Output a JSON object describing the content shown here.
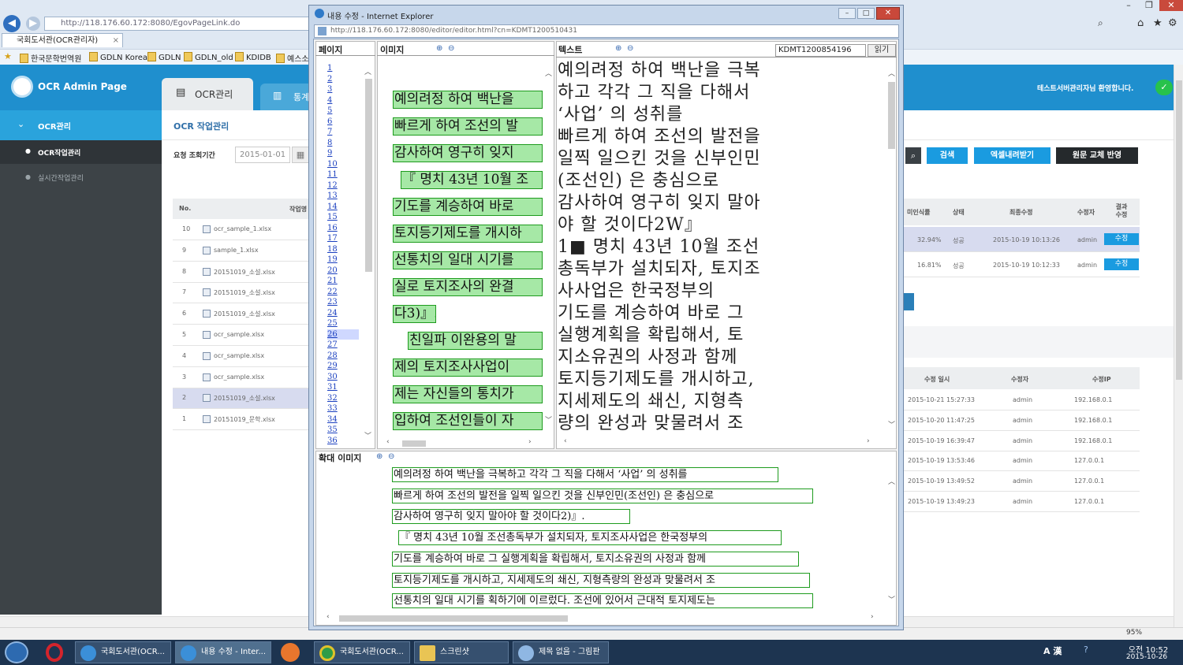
{
  "browser": {
    "address": "http://118.176.60.172:8080/EgovPageLink.do",
    "tab_title": "국회도서관(OCR관리자)",
    "favorites": [
      "한국문학번역원",
      "GDLN Korea",
      "GDLN",
      "GDLN_old",
      "KDIDB",
      "예스소"
    ],
    "zoom": "95%"
  },
  "app": {
    "title": "OCR Admin Page",
    "top_tabs": [
      "OCR관리",
      "통계"
    ],
    "welcome": "테스트서버관리자님 환영합니다.",
    "sidebar": {
      "section": "OCR관리",
      "items": [
        "OCR작업관리",
        "실시간작업관리"
      ]
    },
    "page_title": "OCR 작업관리",
    "filter_label": "요청 조회기간",
    "filter_date": "2015-01-01",
    "buttons": {
      "search": "검색",
      "excel": "엑셀내려받기",
      "apply": "원문 교체 반영"
    },
    "table_headers": {
      "no": "No.",
      "work": "작업명",
      "unrecognized": "미인식률",
      "status": "상태",
      "last_modified": "최종수정",
      "modifier": "수정자",
      "result_edit": "결과 수정"
    },
    "rows": [
      {
        "no": "10",
        "file": "ocr_sample_1.xlsx"
      },
      {
        "no": "9",
        "file": "sample_1.xlsx"
      },
      {
        "no": "8",
        "file": "20151019_소설.xlsx"
      },
      {
        "no": "7",
        "file": "20151019_소설.xlsx"
      },
      {
        "no": "6",
        "file": "20151019_소설.xlsx"
      },
      {
        "no": "5",
        "file": "ocr_sample.xlsx"
      },
      {
        "no": "4",
        "file": "ocr_sample.xlsx"
      },
      {
        "no": "3",
        "file": "ocr_sample.xlsx"
      },
      {
        "no": "2",
        "file": "20151019_소설.xlsx"
      },
      {
        "no": "1",
        "file": "20151019_문학.xlsx"
      }
    ],
    "right_rows": [
      {
        "rate": "32.94%",
        "status": "성공",
        "date": "2015-10-19 10:13:26",
        "user": "admin",
        "action": "수정"
      },
      {
        "rate": "16.81%",
        "status": "성공",
        "date": "2015-10-19 10:12:33",
        "user": "admin",
        "action": "수정"
      }
    ],
    "history_headers": {
      "date": "수정 일시",
      "user": "수정자",
      "ip": "수정IP"
    },
    "history": [
      {
        "date": "2015-10-21 15:27:33",
        "user": "admin",
        "ip": "192.168.0.1"
      },
      {
        "date": "2015-10-20 11:47:25",
        "user": "admin",
        "ip": "192.168.0.1"
      },
      {
        "date": "2015-10-19 16:39:47",
        "user": "admin",
        "ip": "192.168.0.1"
      },
      {
        "date": "2015-10-19 13:53:46",
        "user": "admin",
        "ip": "127.0.0.1"
      },
      {
        "date": "2015-10-19 13:49:52",
        "user": "admin",
        "ip": "127.0.0.1"
      },
      {
        "date": "2015-10-19 13:49:23",
        "user": "admin",
        "ip": "127.0.0.1"
      }
    ]
  },
  "popup": {
    "title": "내용 수정 - Internet Explorer",
    "address": "http://118.176.60.172:8080/editor/editor.html?cn=KDMT1200510431",
    "page_label": "페이지",
    "image_label": "이미지",
    "text_label": "텍스트",
    "zoom_label": "확대 이미지",
    "doc_id": "KDMT1200854196",
    "read_button": "읽기",
    "pages": [
      "1",
      "2",
      "3",
      "4",
      "5",
      "6",
      "7",
      "8",
      "9",
      "10",
      "11",
      "12",
      "13",
      "14",
      "15",
      "16",
      "17",
      "18",
      "19",
      "20",
      "21",
      "22",
      "23",
      "24",
      "25",
      "26",
      "27",
      "28",
      "29",
      "30",
      "31",
      "32",
      "33",
      "34",
      "35",
      "36"
    ],
    "image_lines": [
      "예의려정 하여 백난을",
      "빠르게 하여 조선의 발",
      "감사하여 영구히 잊지",
      "『 명치 43년 10월 조",
      "기도를 계승하여 바로",
      "토지등기제도를 개시하",
      "선통치의 일대 시기를",
      "실로 토지조사의 완결",
      "다3)』.",
      "친일파 이완용의 말",
      "제의 토지조사사업이",
      "제는 자신들의 통치가",
      "입하여 조선인들이 자"
    ],
    "text_lines": [
      "예의려정 하여 백난을 극복",
      "하고 각각 그 직을 다해서",
      "‘사업’ 의 성취를",
      "빠르게 하여 조선의 발전을",
      "일찍 일으킨 것을 신부인민",
      "(조선인) 은 충심으로",
      "감사하여 영구히 잊지 말아",
      "야 할 것이다2W』",
      "1■ 명치 43년 10월 조선",
      "총독부가 설치되자, 토지조",
      "사사업은 한국정부의",
      "기도를 계승하여 바로 그",
      "실행계획을 확립해서, 토",
      "지소유권의 사정과 함께",
      "토지등기제도를 개시하고,",
      "지세제도의 쇄신, 지형측",
      "량의 완성과 맞물려서 조"
    ],
    "zoom_lines": [
      "예의려정 하여 백난을 극복하고 각각 그 직을 다해서 ‘사업’ 의 성취를",
      "빠르게 하여 조선의 발전을 일찍 일으킨 것을 신부인민(조선인) 은 충심으로",
      "감사하여 영구히 잊지 말아야 할 것이다2)』.",
      "『 명치 43년 10월 조선총독부가 설치되자, 토지조사사업은 한국정부의",
      "기도를 계승하여 바로 그 실행계획을 확립해서, 토지소유권의 사정과 함께",
      "토지등기제도를 개시하고, 지세제도의 쇄신, 지형측량의 완성과 맞물려서 조",
      "선통치의 일대 시기를 획하기에 이르렀다. 조선에 있어서 근대적 토지제도는"
    ]
  },
  "taskbar": {
    "items": [
      "국회도서관(OCR...",
      "내용 수정 - Inter...",
      "",
      "국회도서관(OCR...",
      "스크린샷",
      "제목 없음 - 그림판"
    ],
    "time": "오전 10:52",
    "date": "2015-10-26"
  }
}
